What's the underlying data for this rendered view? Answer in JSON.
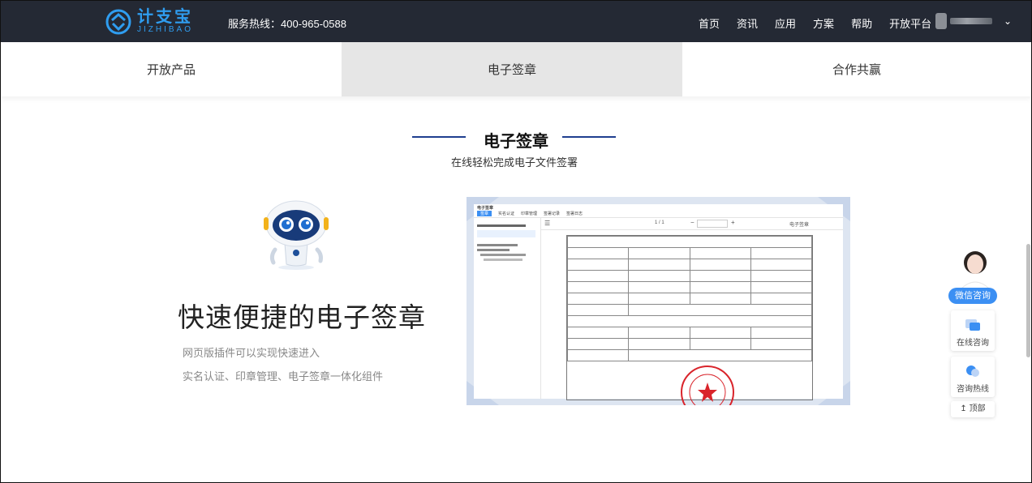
{
  "header": {
    "logo_cn": "计支宝",
    "logo_en": "JIZHIBAO",
    "hotline": "服务热线：400-965-0588",
    "nav": [
      "首页",
      "资讯",
      "应用",
      "方案",
      "帮助",
      "开放平台"
    ]
  },
  "tabs": [
    {
      "label": "开放产品",
      "active": false
    },
    {
      "label": "电子签章",
      "active": true
    },
    {
      "label": "合作共赢",
      "active": false
    }
  ],
  "section": {
    "title": "电子签章",
    "subtitle": "在线轻松完成电子文件签署"
  },
  "feature": {
    "title": "快速便捷的电子签章",
    "line1": "网页版插件可以实现快速进入",
    "line2": "实名认证、印章管理、电子签章一体化组件"
  },
  "mockup": {
    "tabs": [
      "电子签章",
      "实名认证",
      "印章管理",
      "签署记录",
      "签署日志"
    ],
    "page_indicator": "1 / 1",
    "sign_button": "电子签章"
  },
  "float": {
    "wechat": "微信咨询",
    "online": "在线咨询",
    "hotline": "咨询热线",
    "top": "顶部"
  },
  "colors": {
    "header_bg": "#242934",
    "brand_blue": "#2f9df0",
    "accent_blue": "#3b8ff3",
    "seal_red": "#d9242b",
    "tab_active_bg": "#e6e6e6"
  }
}
